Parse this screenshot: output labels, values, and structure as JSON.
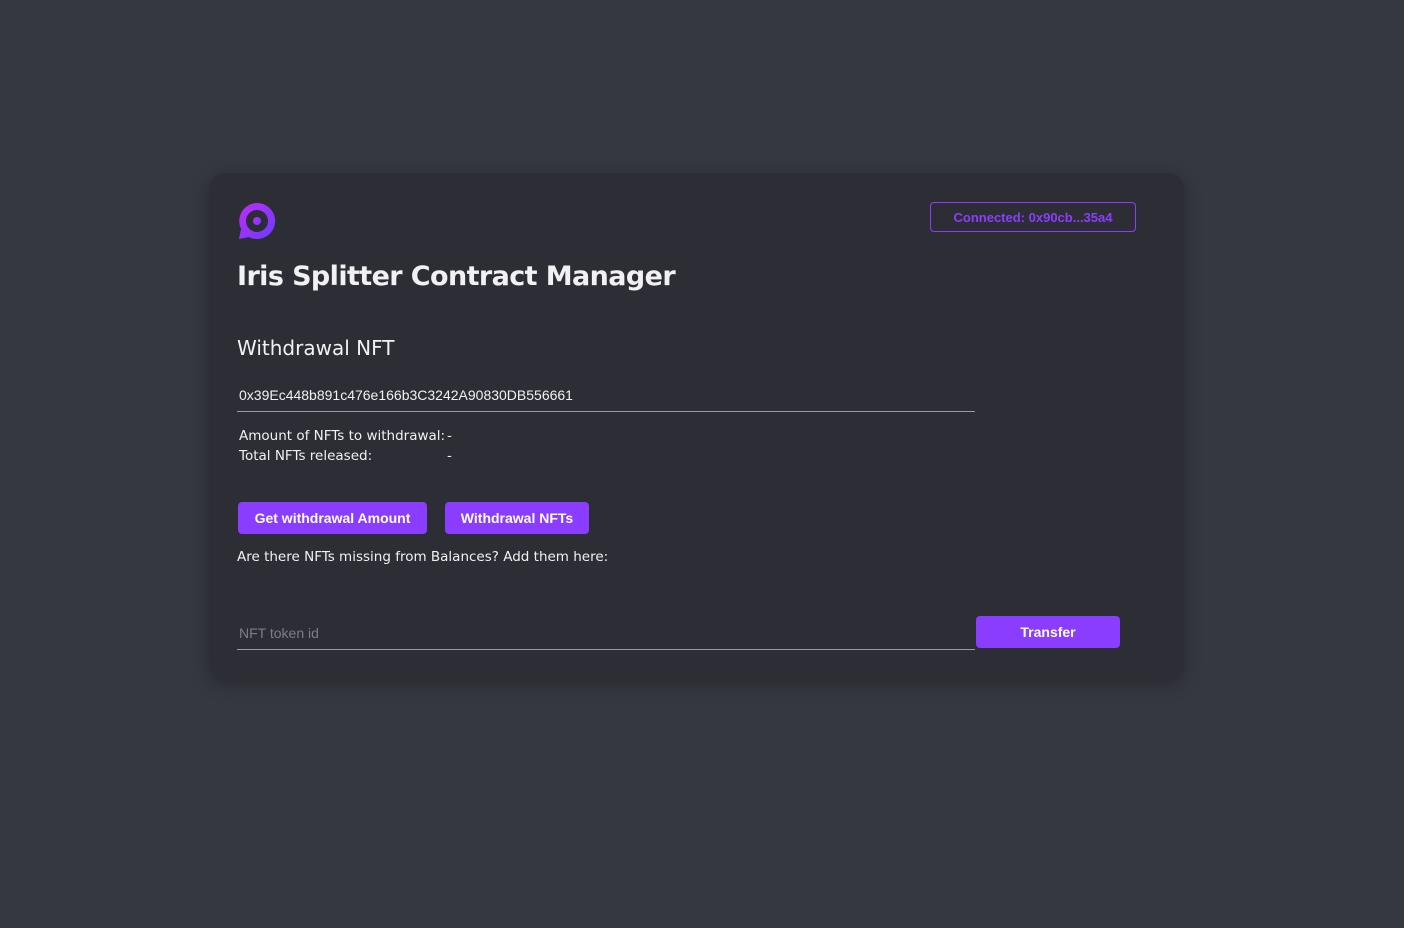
{
  "header": {
    "logo_icon": "iris-logo-icon",
    "connected_label": "Connected: 0x90cb...35a4"
  },
  "page": {
    "title": "Iris Splitter Contract Manager"
  },
  "withdrawal": {
    "section_title": "Withdrawal NFT",
    "contract_address_value": "0x39Ec448b891c476e166b3C3242A90830DB556661",
    "amount_label": "Amount of NFTs to withdrawal:",
    "amount_value": "-",
    "released_label": "Total NFTs released:",
    "released_value": "-",
    "get_amount_label": "Get withdrawal Amount",
    "withdraw_label": "Withdrawal NFTs"
  },
  "missing": {
    "text": "Are there NFTs missing from Balances? Add them here:",
    "token_placeholder": "NFT token id",
    "token_value": "",
    "transfer_label": "Transfer"
  },
  "colors": {
    "background": "#363840",
    "card": "#2d2e35",
    "accent": "#8a3cff",
    "text": "#f1f1f3"
  }
}
